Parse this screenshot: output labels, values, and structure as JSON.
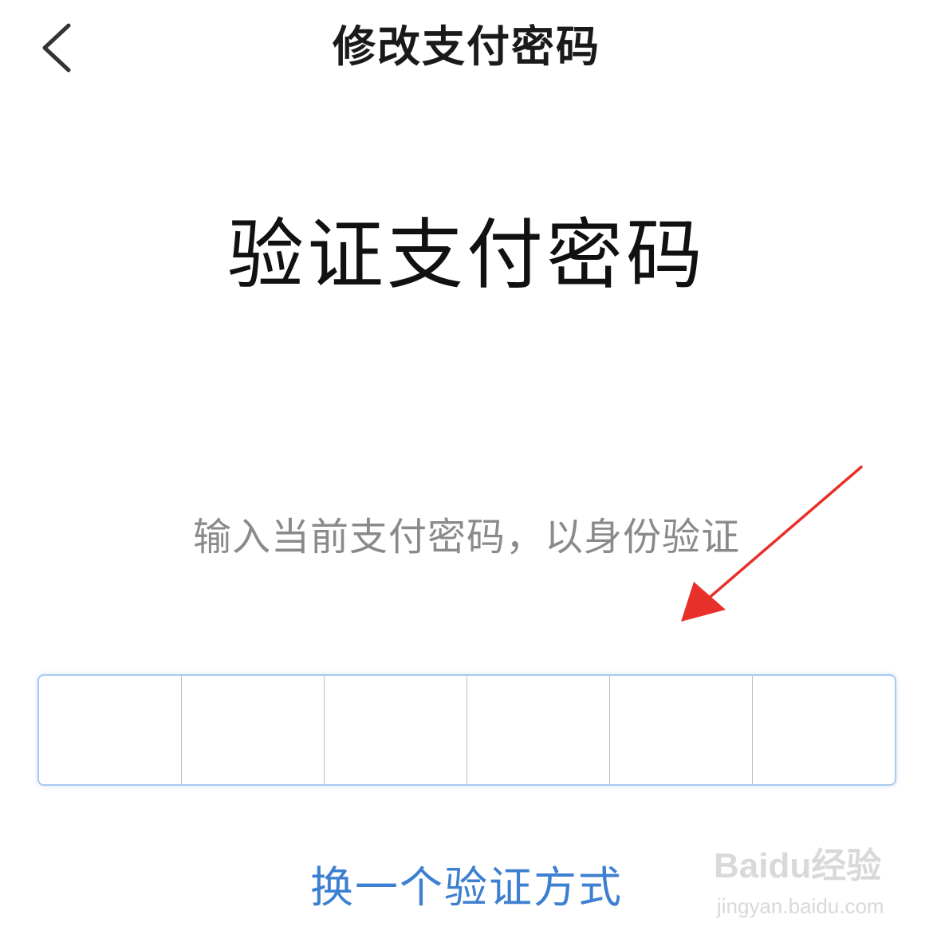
{
  "nav": {
    "title": "修改支付密码",
    "back_icon": "chevron-left-icon"
  },
  "main": {
    "heading": "验证支付密码",
    "hint": "输入当前支付密码，以身份验证",
    "pin_length": 6,
    "switch_link": "换一个验证方式"
  },
  "annotation": {
    "arrow_color": "#e8302a"
  },
  "watermark": {
    "brand": "Baidu经验",
    "site": "jingyan.baidu.com"
  },
  "colors": {
    "link": "#3d7fd0",
    "hint": "#8a8a8a",
    "pin_border": "#a9c9ef"
  }
}
